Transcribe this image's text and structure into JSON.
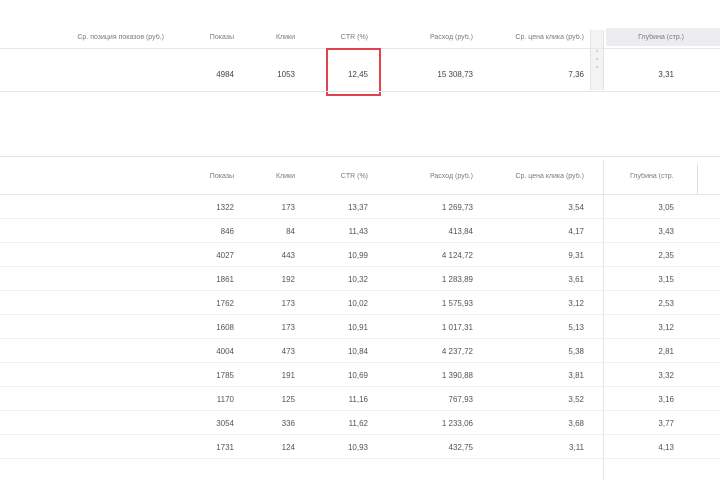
{
  "summary_header": {
    "columns": [
      {
        "key": "impressions",
        "label": "Показы"
      },
      {
        "key": "clicks",
        "label": "Клики"
      },
      {
        "key": "ctr",
        "label": "CTR (%)"
      },
      {
        "key": "spend",
        "label": "Расход (руб.)"
      },
      {
        "key": "cpc",
        "label": "Ср. цена клика (руб.)"
      },
      {
        "key": "extra",
        "label": "Глубина (стр.)"
      }
    ],
    "first_label": "Ср. позиция показов (руб.)"
  },
  "summary_row": {
    "values": [
      "4984",
      "1053",
      "12,45",
      "15 308,73",
      "7,36",
      "3,31"
    ],
    "highlighted": "ctr"
  },
  "detail_header": {
    "columns": [
      "Показы",
      "Клики",
      "CTR (%)",
      "Расход (руб.)",
      "Ср. цена клика (руб.)",
      "Глубина (стр.)"
    ]
  },
  "detail_rows": [
    [
      "1322",
      "173",
      "13,37",
      "1 269,73",
      "3,54",
      "3,05"
    ],
    [
      "846",
      "84",
      "11,43",
      "413,84",
      "4,17",
      "3,43"
    ],
    [
      "4027",
      "443",
      "10,99",
      "4 124,72",
      "9,31",
      "2,35"
    ],
    [
      "1861",
      "192",
      "10,32",
      "1 283,89",
      "3,61",
      "3,15"
    ],
    [
      "1762",
      "173",
      "10,02",
      "1 575,93",
      "3,12",
      "2,53"
    ],
    [
      "1608",
      "173",
      "10,91",
      "1 017,31",
      "5,13",
      "3,12"
    ],
    [
      "4004",
      "473",
      "10,84",
      "4 237,72",
      "5,38",
      "2,81"
    ],
    [
      "1785",
      "191",
      "10,69",
      "1 390,88",
      "3,81",
      "3,32"
    ],
    [
      "1170",
      "125",
      "11,16",
      "767,93",
      "3,52",
      "3,16"
    ],
    [
      "3054",
      "336",
      "11,62",
      "1 233,06",
      "3,68",
      "3,77"
    ],
    [
      "1731",
      "124",
      "10,93",
      "432,75",
      "3,11",
      "4,13"
    ]
  ],
  "colors": {
    "highlight_border": "#e0424f",
    "header_shaded_bg": "#ececf1",
    "row_border": "#ebebeb"
  }
}
